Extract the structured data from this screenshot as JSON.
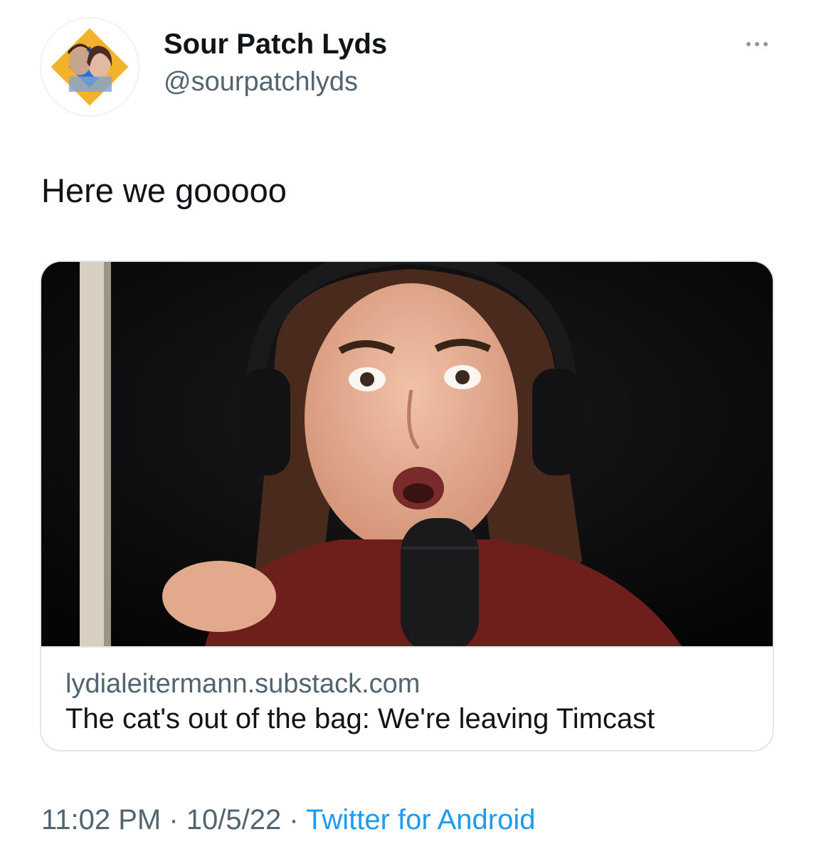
{
  "author": {
    "display_name": "Sour Patch Lyds",
    "handle": "@sourpatchlyds",
    "avatar_icon": "profile-photo",
    "avatar_colors": {
      "diamond": "#f2b32a",
      "inner": "#2a6fd1"
    }
  },
  "more_icon": "ellipsis-icon",
  "tweet": {
    "text": "Here we gooooo"
  },
  "link_card": {
    "image_description_icon": "link-preview-image",
    "domain": "lydialeitermann.substack.com",
    "title": "The cat's out of the bag: We're leaving Timcast"
  },
  "meta": {
    "time": "11:02 PM",
    "separator": " · ",
    "date": "10/5/22",
    "source": "Twitter for Android"
  },
  "colors": {
    "text_primary": "#0f1419",
    "text_secondary": "#536471",
    "link_blue": "#1d9bf0",
    "border": "#e1e6ea"
  }
}
